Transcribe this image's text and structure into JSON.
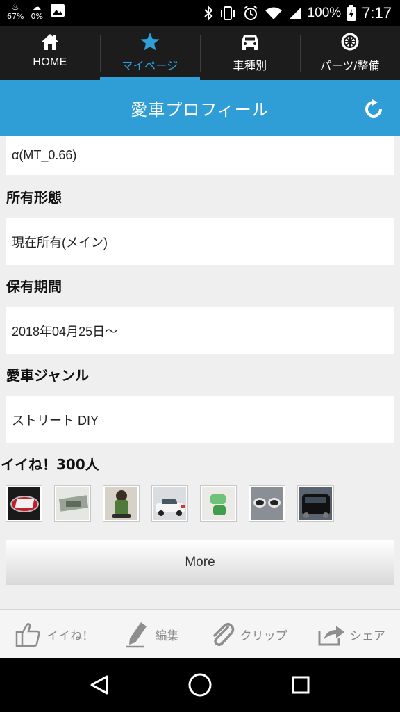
{
  "status_bar": {
    "left_items": [
      {
        "icon": "battery-saver-icon",
        "text": "67%"
      },
      {
        "icon": "weather-icon",
        "text": "0%"
      },
      {
        "icon": "image-notification-icon",
        "text": ""
      }
    ],
    "right_icons": [
      "bluetooth-icon",
      "vibrate-icon",
      "alarm-icon",
      "wifi-icon",
      "signal-icon"
    ],
    "battery": "100%",
    "time": "7:17"
  },
  "top_nav": [
    {
      "label": "HOME",
      "icon": "home-icon",
      "active": false
    },
    {
      "label": "マイページ",
      "icon": "star-icon",
      "active": true
    },
    {
      "label": "車種別",
      "icon": "car-icon",
      "active": false
    },
    {
      "label": "パーツ/整備",
      "icon": "wheel-icon",
      "active": false
    }
  ],
  "title_bar": {
    "title": "愛車プロフィール",
    "refresh_icon": "refresh-icon"
  },
  "profile": {
    "grade_value": "α(MT_0.66)",
    "ownership_label": "所有形態",
    "ownership_value": "現在所有(メイン)",
    "period_label": "保有期間",
    "period_value": "2018年04月25日～",
    "genre_label": "愛車ジャンル",
    "genre_value": "ストリート DIY"
  },
  "likes": {
    "title": "イイね！300人",
    "more_label": "More",
    "thumbnails": [
      "sti-emblem",
      "car-parts",
      "figure",
      "white-car",
      "green-parts",
      "exhaust-tips",
      "black-car"
    ]
  },
  "action_bar": [
    {
      "label": "イイね！",
      "icon": "thumbs-up-icon"
    },
    {
      "label": "編集",
      "icon": "pen-icon"
    },
    {
      "label": "クリップ",
      "icon": "paperclip-icon"
    },
    {
      "label": "シェア",
      "icon": "share-icon"
    }
  ],
  "colors": {
    "accent": "#2e9fd8",
    "nav_bg": "#1c1c1c",
    "page_bg": "#efefef"
  }
}
